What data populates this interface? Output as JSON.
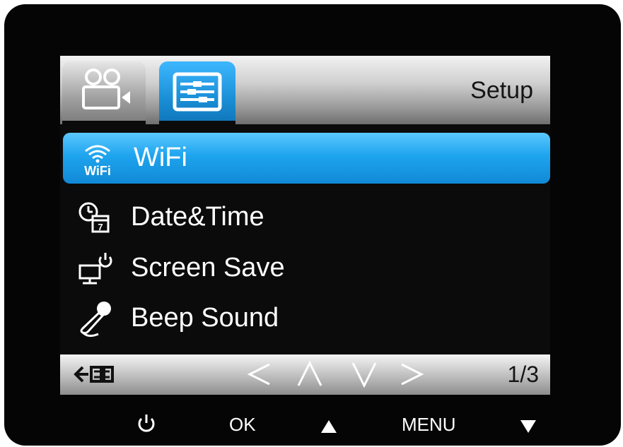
{
  "header": {
    "title": "Setup"
  },
  "tabs": [
    {
      "icon": "video-camera-icon"
    },
    {
      "icon": "settings-list-icon"
    }
  ],
  "menu": {
    "items": [
      {
        "label": "WiFi",
        "icon": "wifi-icon",
        "selected": true
      },
      {
        "label": "Date&Time",
        "icon": "clock-calendar-icon",
        "selected": false
      },
      {
        "label": "Screen Save",
        "icon": "monitor-power-icon",
        "selected": false
      },
      {
        "label": "Beep Sound",
        "icon": "microphone-icon",
        "selected": false
      }
    ]
  },
  "bottom_bar": {
    "back_icon": "back-icon",
    "nav": [
      "<",
      "^",
      "v",
      ">"
    ],
    "page": "1/3"
  },
  "hardware_buttons": {
    "power_icon": "power-icon",
    "ok_label": "OK",
    "up_icon": "up-triangle-icon",
    "menu_label": "MENU",
    "down_icon": "down-triangle-icon"
  },
  "colors": {
    "selection": "#1ea4ee",
    "header_gray": "#b5b5b5",
    "background": "#0b0b0b"
  }
}
